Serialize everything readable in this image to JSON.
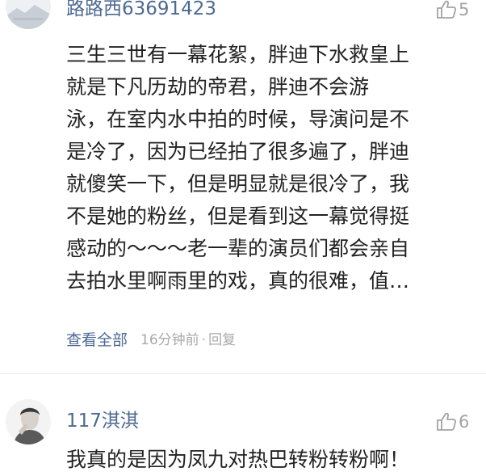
{
  "comments": [
    {
      "username": "路路西63691423",
      "likes": "5",
      "lines": [
        "三生三世有一幕花絮，胖迪下水救皇上",
        "就是下凡历劫的帝君，胖迪不会游",
        "泳，在室内水中拍的时候，导演问是不",
        "是冷了，因为已经拍了很多遍了，胖迪",
        "就傻笑一下，但是明显就是很冷了，我",
        "不是她的粉丝，但是看到这一幕觉得挺",
        "感动的～～～老一辈的演员们都会亲自",
        "去拍水里啊雨里的戏，真的很难，值…"
      ],
      "view_all": "查看全部",
      "time": "16分钟前",
      "separator": "·",
      "reply": "回复"
    },
    {
      "username": "117淇淇",
      "likes": "6",
      "lines": [
        "我真的是因为凤九对热巴转粉转粉啊！"
      ]
    }
  ],
  "icons": {
    "like": "thumbs-up-outline-icon",
    "avatar_1": "landscape-avatar",
    "avatar_2": "portrait-avatar"
  },
  "colors": {
    "username": "#4e6a93",
    "body_text": "#222222",
    "meta_text": "#a9a9a9",
    "like_icon": "#a3a3a3"
  }
}
